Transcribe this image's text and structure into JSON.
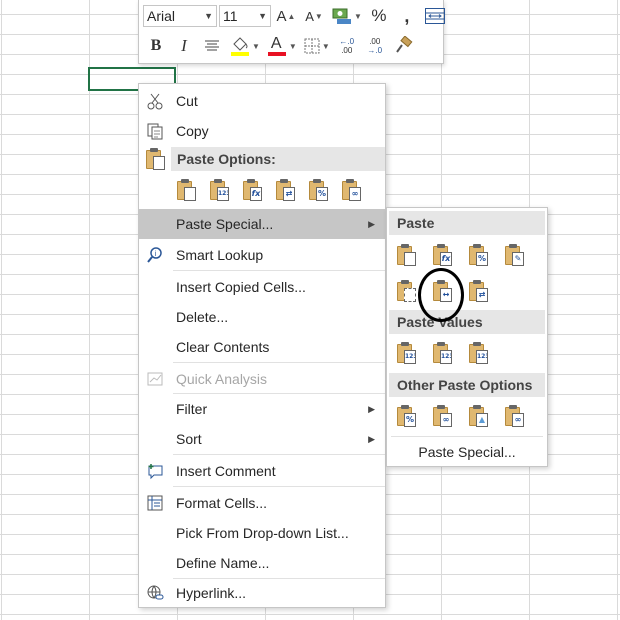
{
  "mini_toolbar": {
    "font_name": "Arial",
    "font_size": "11",
    "grow_font": "A",
    "shrink_font": "A",
    "percent": "%",
    "comma": ",",
    "bold": "B",
    "italic": "I",
    "font_color_letter": "A",
    "inc_decimal": ".00",
    "dec_decimal": ".0"
  },
  "context_menu": {
    "cut": "Cut",
    "copy": "Copy",
    "paste_options_header": "Paste Options:",
    "paste_special": "Paste Special...",
    "smart_lookup": "Smart Lookup",
    "insert_copied_cells": "Insert Copied Cells...",
    "delete": "Delete...",
    "clear_contents": "Clear Contents",
    "quick_analysis": "Quick Analysis",
    "filter": "Filter",
    "sort": "Sort",
    "insert_comment": "Insert Comment",
    "format_cells": "Format Cells...",
    "pick_from_list": "Pick From Drop-down List...",
    "define_name": "Define Name...",
    "hyperlink": "Hyperlink...",
    "paste_icon_labels": [
      "",
      "123",
      "fx",
      "⇄",
      "%",
      "∞"
    ]
  },
  "submenu": {
    "paste_header": "Paste",
    "paste_values_header": "Paste Values",
    "other_header": "Other Paste Options",
    "paste_special_link": "Paste Special...",
    "paste_row1": [
      "",
      "fx",
      "%",
      "✎"
    ],
    "paste_row2": [
      "",
      "↔",
      "⇄"
    ],
    "values_row": [
      "123",
      "123",
      "123"
    ],
    "other_row": [
      "%",
      "∞",
      "▲",
      "∞"
    ]
  },
  "colors": {
    "selection_green": "#217346",
    "highlight_bg": "#c6c6c6",
    "header_bg": "#e6e6e6",
    "fill_yellow": "#ffff00",
    "font_red": "#e81123"
  }
}
